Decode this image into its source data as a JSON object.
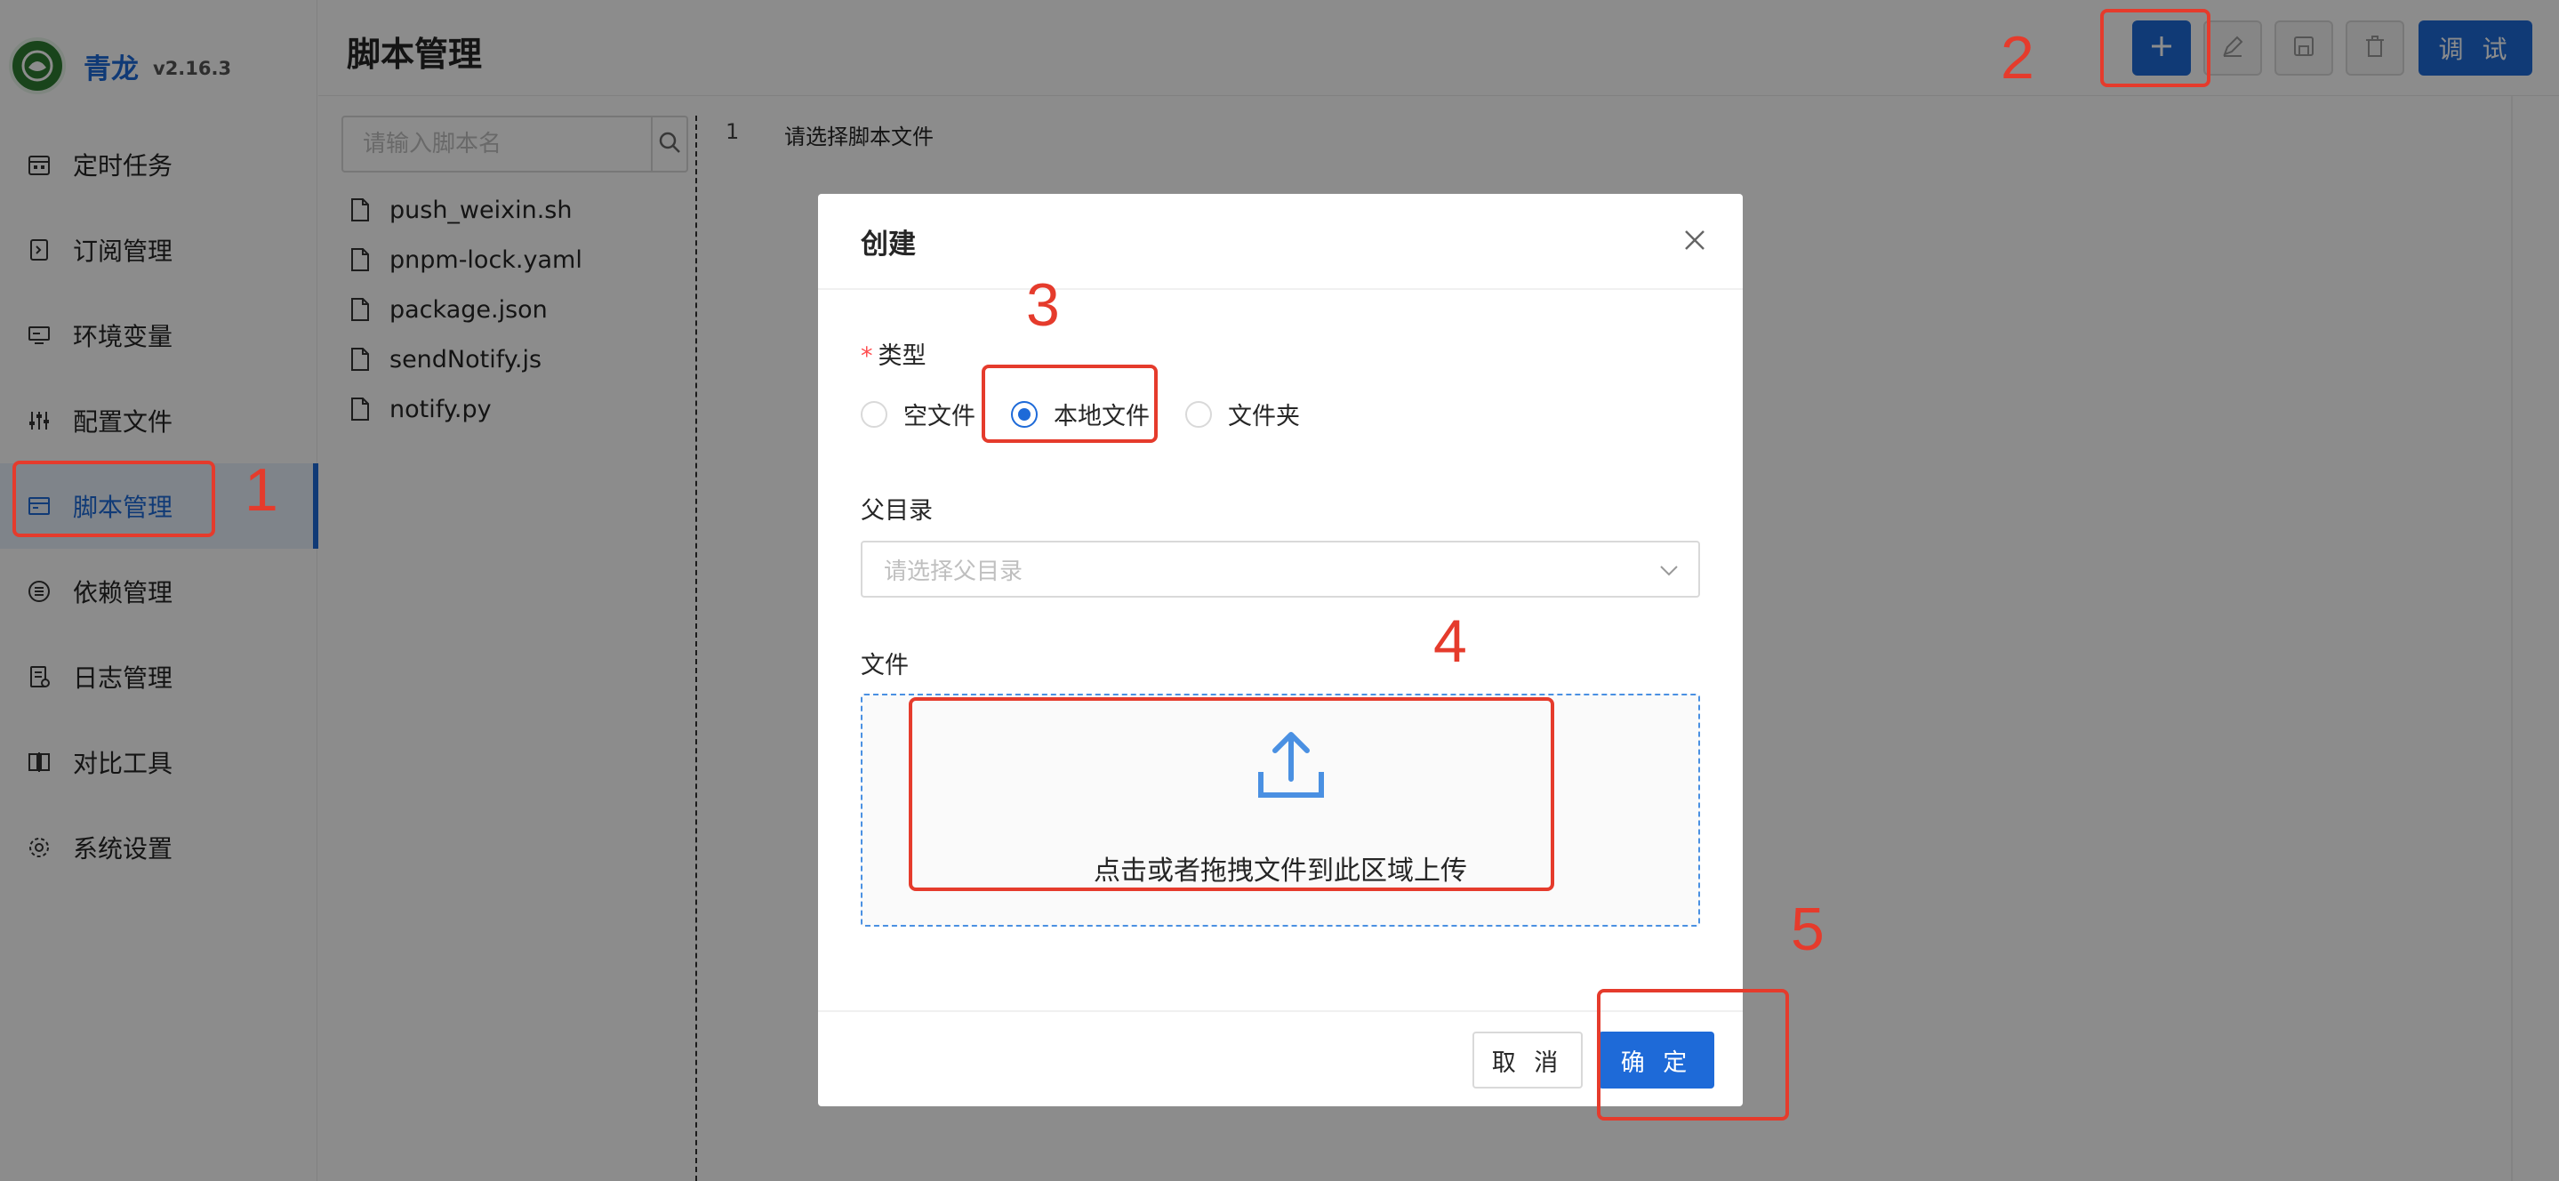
{
  "app": {
    "name": "青龙",
    "version": "v2.16.3",
    "logo_icon": "dragon-logo"
  },
  "sidebar": {
    "items": [
      {
        "label": "定时任务",
        "icon": "calendar-icon"
      },
      {
        "label": "订阅管理",
        "icon": "subscription-icon"
      },
      {
        "label": "环境变量",
        "icon": "monitor-icon"
      },
      {
        "label": "配置文件",
        "icon": "sliders-icon"
      },
      {
        "label": "脚本管理",
        "icon": "script-icon",
        "active": true
      },
      {
        "label": "依赖管理",
        "icon": "list-icon"
      },
      {
        "label": "日志管理",
        "icon": "log-icon"
      },
      {
        "label": "对比工具",
        "icon": "diff-icon"
      },
      {
        "label": "系统设置",
        "icon": "gear-icon"
      }
    ]
  },
  "header": {
    "title": "脚本管理",
    "debug_label": "调 试"
  },
  "file_panel": {
    "search_placeholder": "请输入脚本名",
    "files": [
      "push_weixin.sh",
      "pnpm-lock.yaml",
      "package.json",
      "sendNotify.js",
      "notify.py"
    ]
  },
  "editor": {
    "line_number": "1",
    "placeholder": "请选择脚本文件"
  },
  "modal": {
    "title": "创建",
    "type_label": "类型",
    "type_options": [
      "空文件",
      "本地文件",
      "文件夹"
    ],
    "type_selected": "本地文件",
    "parent_label": "父目录",
    "parent_placeholder": "请选择父目录",
    "file_label": "文件",
    "upload_text": "点击或者拖拽文件到此区域上传",
    "cancel_label": "取 消",
    "ok_label": "确 定"
  },
  "annotations": [
    "1",
    "2",
    "3",
    "4",
    "5"
  ],
  "colors": {
    "primary": "#1e6ad8",
    "annotation": "#e53b2c",
    "mask": "rgba(0,0,0,0.45)"
  }
}
